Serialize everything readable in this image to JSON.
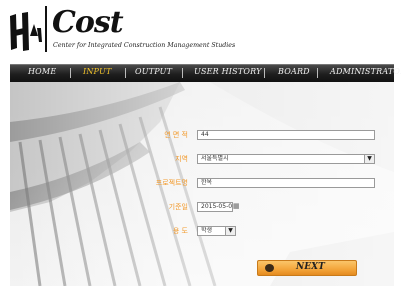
{
  "brand": {
    "logo_mark": "HAN",
    "title": "Cost",
    "subtitle": "Center for Integrated Construction Management Studies"
  },
  "nav": {
    "items": [
      {
        "label": "HOME",
        "active": false
      },
      {
        "label": "INPUT",
        "active": true
      },
      {
        "label": "OUTPUT",
        "active": false
      },
      {
        "label": "USER HISTORY",
        "active": false
      },
      {
        "label": "BOARD",
        "active": false
      },
      {
        "label": "ADMINISTRATOR",
        "active": false
      }
    ],
    "active_color": "#f2c32a"
  },
  "form": {
    "fields": [
      {
        "label": "연 면 적",
        "value": "44",
        "type": "text"
      },
      {
        "label": "지역",
        "value": "서울특별시",
        "type": "select"
      },
      {
        "label": "프로젝트명",
        "value": "한옥",
        "type": "text"
      },
      {
        "label": "기준일",
        "value": "2015-05-0",
        "type": "date"
      },
      {
        "label": "용 도",
        "value": "학생",
        "type": "select"
      }
    ],
    "label_color": "#f29a2c"
  },
  "next_button": {
    "label": "NEXT",
    "color": "#f3a53a"
  },
  "icons": {
    "calendar": "calendar-icon",
    "dropdown": "chevron-down-icon",
    "bullet": "circle-bullet-icon"
  }
}
